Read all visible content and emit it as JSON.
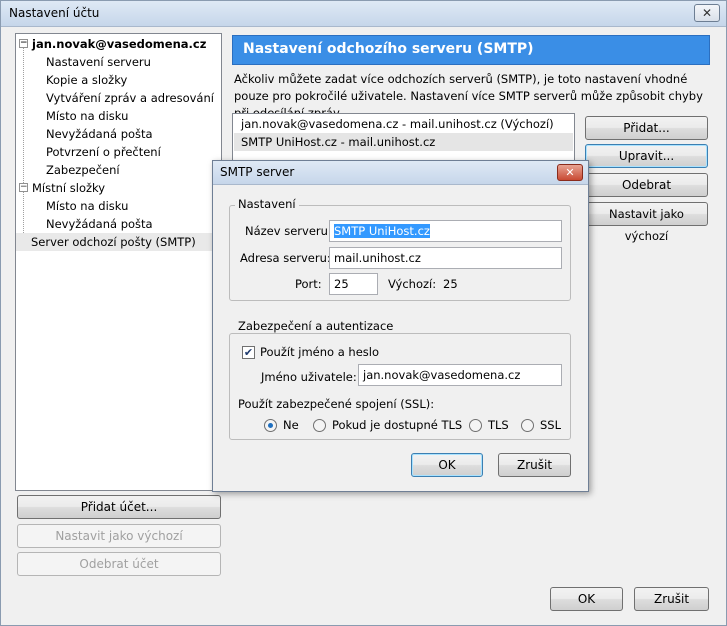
{
  "window": {
    "title": "Nastavení účtu",
    "close_glyph": "✕"
  },
  "tree": {
    "account": "jan.novak@vasedomena.cz",
    "account_items": [
      "Nastavení serveru",
      "Kopie a složky",
      "Vytváření zpráv a adresování",
      "Místo na disku",
      "Nevyžádaná pošta",
      "Potvrzení o přečtení",
      "Zabezpečení"
    ],
    "local": "Místní složky",
    "local_items": [
      "Místo na disku",
      "Nevyžádaná pošta"
    ],
    "smtp": "Server odchozí pošty (SMTP)",
    "expander_glyph": "−"
  },
  "left_buttons": {
    "add": "Přidat účet...",
    "set_default": "Nastavit jako výchozí",
    "remove": "Odebrat účet"
  },
  "pane": {
    "title": "Nastavení odchozího serveru (SMTP)",
    "description": "Ačkoliv můžete zadat více odchozích serverů (SMTP), je toto nastavení vhodné pouze pro pokročilé uživatele. Nastavení více SMTP serverů může způsobit chyby při odesílání zpráv.",
    "servers": [
      "jan.novak@vasedomena.cz - mail.unihost.cz (Výchozí)",
      "SMTP UniHost.cz - mail.unihost.cz"
    ],
    "buttons": {
      "add": "Přidat...",
      "edit": "Upravit...",
      "remove": "Odebrat",
      "set_default": "Nastavit jako výchozí"
    }
  },
  "dialog": {
    "title": "SMTP server",
    "close_glyph": "✕",
    "settings_legend": "Nastavení",
    "server_name_label": "Název serveru",
    "server_name_value": "SMTP UniHost.cz",
    "server_address_label": "Adresa serveru:",
    "server_address_value": "mail.unihost.cz",
    "port_label": "Port:",
    "port_value": "25",
    "default_label": "Výchozí:",
    "default_value": "25",
    "security_legend": "Zabezpečení a autentizace",
    "use_name_label": "Použít jméno a heslo",
    "use_name_checked": true,
    "check_glyph": "✔",
    "username_label": "Jméno uživatele:",
    "username_value": "jan.novak@vasedomena.cz",
    "ssl_label": "Použít zabezpečené spojení (SSL):",
    "ssl_options": [
      "Ne",
      "Pokud je dostupné TLS",
      "TLS",
      "SSL"
    ],
    "ssl_selected": "Ne",
    "ok": "OK",
    "cancel": "Zrušit"
  },
  "footer": {
    "ok": "OK",
    "cancel": "Zrušit"
  }
}
